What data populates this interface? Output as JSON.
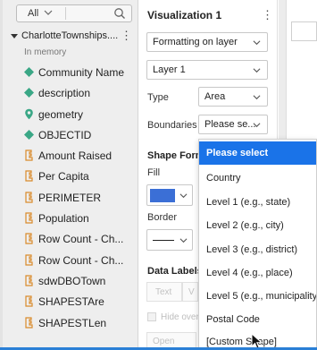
{
  "data_pane": {
    "filter_label": "All",
    "source_name": "CharlotteTownships....",
    "source_sub": "In memory",
    "fields": [
      {
        "label": "Community Name",
        "icon": "dimension-diamond-icon"
      },
      {
        "label": "description",
        "icon": "dimension-diamond-icon"
      },
      {
        "label": "geometry",
        "icon": "geometry-pin-icon"
      },
      {
        "label": "OBJECTID",
        "icon": "dimension-diamond-icon"
      },
      {
        "label": "Amount Raised",
        "icon": "measure-ruler-icon"
      },
      {
        "label": "Per Capita",
        "icon": "measure-ruler-icon"
      },
      {
        "label": "PERIMETER",
        "icon": "measure-ruler-icon"
      },
      {
        "label": "Population",
        "icon": "measure-ruler-icon"
      },
      {
        "label": "Row Count - Ch...",
        "icon": "measure-ruler-icon"
      },
      {
        "label": "Row Count - Ch...",
        "icon": "measure-ruler-icon"
      },
      {
        "label": "sdwDBOTown",
        "icon": "measure-ruler-icon"
      },
      {
        "label": "SHAPESTAre",
        "icon": "measure-ruler-icon"
      },
      {
        "label": "SHAPESTLen",
        "icon": "measure-ruler-icon"
      }
    ]
  },
  "viz_pane": {
    "title": "Visualization 1",
    "formatting_select": "Formatting on layer",
    "layer_select": "Layer 1",
    "type_label": "Type",
    "type_value": "Area",
    "boundaries_label": "Boundaries",
    "boundaries_value": "Please se...",
    "shape_format_heading": "Shape Form",
    "fill_label": "Fill",
    "fill_color": "#3b6fd6",
    "border_label": "Border",
    "data_labels_heading": "Data Labels",
    "text_btn": "Text",
    "value_btn": "V",
    "hide_overlap": "Hide over",
    "font_name": "Open Sans"
  },
  "dropdown": {
    "items": [
      "Please select",
      "Country",
      "Level 1 (e.g., state)",
      "Level 2 (e.g., city)",
      "Level 3 (e.g., district)",
      "Level 4 (e.g., place)",
      "Level 5 (e.g., municipality)",
      "Postal Code",
      "[Custom Shape]"
    ],
    "selected_index": 0,
    "selected_color": "#1a73e8"
  }
}
